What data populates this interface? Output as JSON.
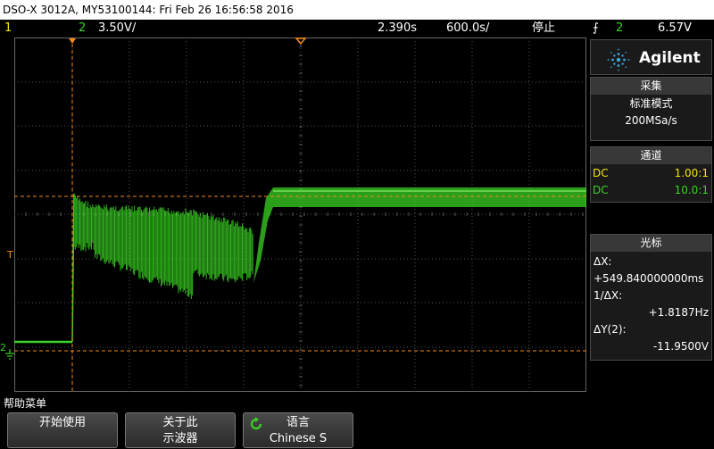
{
  "title": "DSO-X 3012A, MY53100144: Fri Feb 26 16:56:58 2016",
  "status": {
    "ch1_num": "1",
    "ch2_num": "2",
    "ch2_scale": "3.50V/",
    "time_delay": "2.390s",
    "time_scale": "600.0s/",
    "run_state": "停止",
    "trig_source": "2",
    "trig_level": "6.57V"
  },
  "brand": "Agilent",
  "acquire": {
    "header": "采集",
    "mode": "标准模式",
    "rate": "200MSa/s"
  },
  "channels": {
    "header": "通道",
    "items": [
      {
        "coupling": "DC",
        "probe": "1.00:1",
        "color": "#f2e600"
      },
      {
        "coupling": "DC",
        "probe": "10.0:1",
        "color": "#39d422"
      }
    ]
  },
  "cursors": {
    "header": "光标",
    "dx_label": "ΔX:",
    "dx_value": "+549.840000000ms",
    "inv_dx_label": "1/ΔX:",
    "inv_dx_value": "+1.8187Hz",
    "dy_label": "ΔY(2):",
    "dy_value": "-11.9500V"
  },
  "softkeys": {
    "menu_label": "帮助菜单",
    "start": "开始使用",
    "about_line1": "关于此",
    "about_line2": "示波器",
    "lang_title": "语言",
    "lang_value": "Chinese S"
  },
  "markers": {
    "trigger": "T",
    "ch2_ground": "2"
  },
  "colors": {
    "ch1": "#f2e600",
    "ch2": "#39d422",
    "cursor": "#f08a1e",
    "grid": "#555555"
  }
}
